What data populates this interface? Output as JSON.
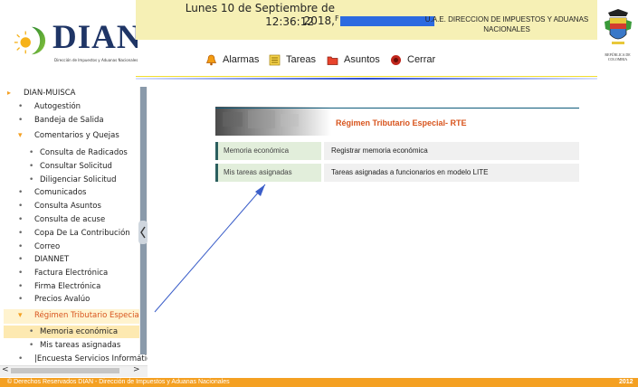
{
  "header": {
    "logo_text": "DIAN",
    "logo_subtitle": "Dirección de Impuestos y Aduanas Nacionales",
    "date": "Lunes 10 de Septiembre de 2018,",
    "time": "12:36:12",
    "user_prefix": "F",
    "entity": "U.A.E. DIRECCION DE IMPUESTOS Y ADUANAS NACIONALES",
    "crest_label": "REPÚBLICA DE COLOMBIA",
    "menu": [
      {
        "label": "Alarmas",
        "icon": "bell-icon"
      },
      {
        "label": "Tareas",
        "icon": "tasks-icon"
      },
      {
        "label": "Asuntos",
        "icon": "folder-icon"
      },
      {
        "label": "Cerrar",
        "icon": "close-icon"
      }
    ]
  },
  "sidebar": {
    "root": "DIAN-MUISCA",
    "items": [
      {
        "label": "Autogestión"
      },
      {
        "label": "Bandeja de Salida"
      },
      {
        "label": "Comentarios y Quejas",
        "expanded": true
      },
      {
        "label": "Consulta de Radicados"
      },
      {
        "label": "Consultar Solicitud"
      },
      {
        "label": "Diligenciar Solicitud"
      },
      {
        "label": "Comunicados"
      },
      {
        "label": "Consulta Asuntos"
      },
      {
        "label": "Consulta de acuse"
      },
      {
        "label": "Copa De La Contribución"
      },
      {
        "label": "Correo"
      },
      {
        "label": "DIANNET"
      },
      {
        "label": "Factura Electrónica"
      },
      {
        "label": "Firma Electrónica"
      },
      {
        "label": "Precios Avalúo"
      },
      {
        "label": "Régimen Tributario Especial- RTE",
        "expanded": true
      },
      {
        "label": "Memoria económica",
        "selected": true
      },
      {
        "label": "Mis tareas asignadas"
      },
      {
        "label": "|Encuesta Servicios Informáticos"
      }
    ]
  },
  "content": {
    "title": "Régimen Tributario Especial- RTE",
    "rows": [
      {
        "name": "Memoria económica",
        "description": "Registrar memoria económica"
      },
      {
        "name": "Mis tareas asignadas",
        "description": "Tareas asignadas a funcionarios en modelo LITE"
      }
    ]
  },
  "footer": {
    "text": "© Derechos Reservados DIAN - Dirección de Impuestos y Aduanas Nacionales",
    "year": "2012"
  },
  "colors": {
    "header_yellow": "#f6f0b5",
    "accent_orange": "#f4a022",
    "title_orange": "#d8551e",
    "selection": "#fde9b1",
    "row_green": "#e2eedb"
  }
}
